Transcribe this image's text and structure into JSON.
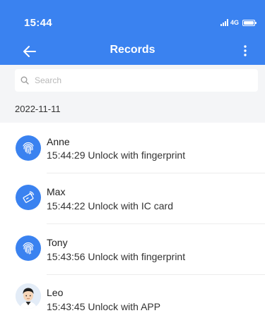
{
  "status_bar": {
    "time": "15:44",
    "network": "4G"
  },
  "header": {
    "title": "Records"
  },
  "search": {
    "placeholder": "Search"
  },
  "records_date": "2022-11-11",
  "records": [
    {
      "name": "Anne",
      "detail": "15:44:29 Unlock with fingerprint",
      "icon": "fingerprint-icon"
    },
    {
      "name": "Max",
      "detail": "15:44:22 Unlock with IC card",
      "icon": "ic-card-icon"
    },
    {
      "name": "Tony",
      "detail": "15:43:56 Unlock with fingerprint",
      "icon": "fingerprint-icon"
    },
    {
      "name": "Leo",
      "detail": "15:43:45 Unlock with APP",
      "icon": "user-avatar"
    }
  ],
  "colors": {
    "primary": "#3a82f0",
    "background": "#f4f5f7"
  }
}
